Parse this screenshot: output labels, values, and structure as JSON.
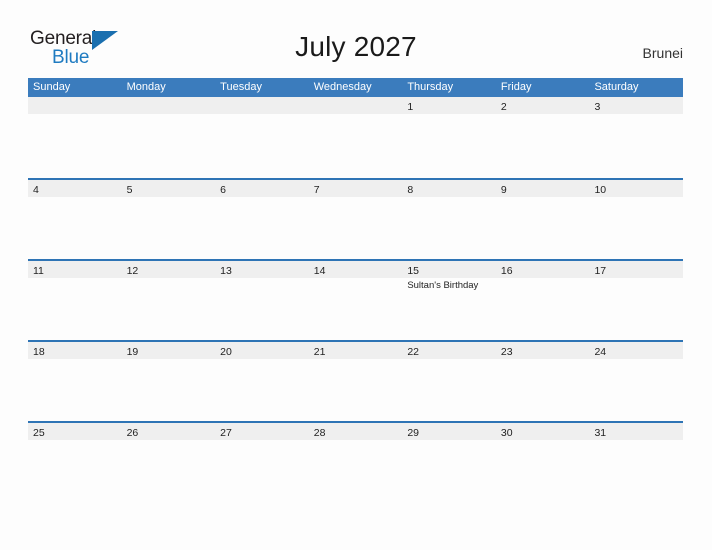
{
  "logo": {
    "word1": "General",
    "word2": "Blue",
    "triangle_color": "#1a6faf",
    "blue_text_color": "#1f7bc1"
  },
  "header": {
    "title": "July 2027",
    "country": "Brunei"
  },
  "calendar": {
    "header_bg": "#3b7cbd",
    "row_border_color": "#2e74b5",
    "day_band_bg": "#efefef",
    "weekdays": [
      "Sunday",
      "Monday",
      "Tuesday",
      "Wednesday",
      "Thursday",
      "Friday",
      "Saturday"
    ],
    "weeks": [
      [
        {
          "num": "",
          "events": []
        },
        {
          "num": "",
          "events": []
        },
        {
          "num": "",
          "events": []
        },
        {
          "num": "",
          "events": []
        },
        {
          "num": "1",
          "events": []
        },
        {
          "num": "2",
          "events": []
        },
        {
          "num": "3",
          "events": []
        }
      ],
      [
        {
          "num": "4",
          "events": []
        },
        {
          "num": "5",
          "events": []
        },
        {
          "num": "6",
          "events": []
        },
        {
          "num": "7",
          "events": []
        },
        {
          "num": "8",
          "events": []
        },
        {
          "num": "9",
          "events": []
        },
        {
          "num": "10",
          "events": []
        }
      ],
      [
        {
          "num": "11",
          "events": []
        },
        {
          "num": "12",
          "events": []
        },
        {
          "num": "13",
          "events": []
        },
        {
          "num": "14",
          "events": []
        },
        {
          "num": "15",
          "events": [
            "Sultan's Birthday"
          ]
        },
        {
          "num": "16",
          "events": []
        },
        {
          "num": "17",
          "events": []
        }
      ],
      [
        {
          "num": "18",
          "events": []
        },
        {
          "num": "19",
          "events": []
        },
        {
          "num": "20",
          "events": []
        },
        {
          "num": "21",
          "events": []
        },
        {
          "num": "22",
          "events": []
        },
        {
          "num": "23",
          "events": []
        },
        {
          "num": "24",
          "events": []
        }
      ],
      [
        {
          "num": "25",
          "events": []
        },
        {
          "num": "26",
          "events": []
        },
        {
          "num": "27",
          "events": []
        },
        {
          "num": "28",
          "events": []
        },
        {
          "num": "29",
          "events": []
        },
        {
          "num": "30",
          "events": []
        },
        {
          "num": "31",
          "events": []
        }
      ]
    ]
  }
}
